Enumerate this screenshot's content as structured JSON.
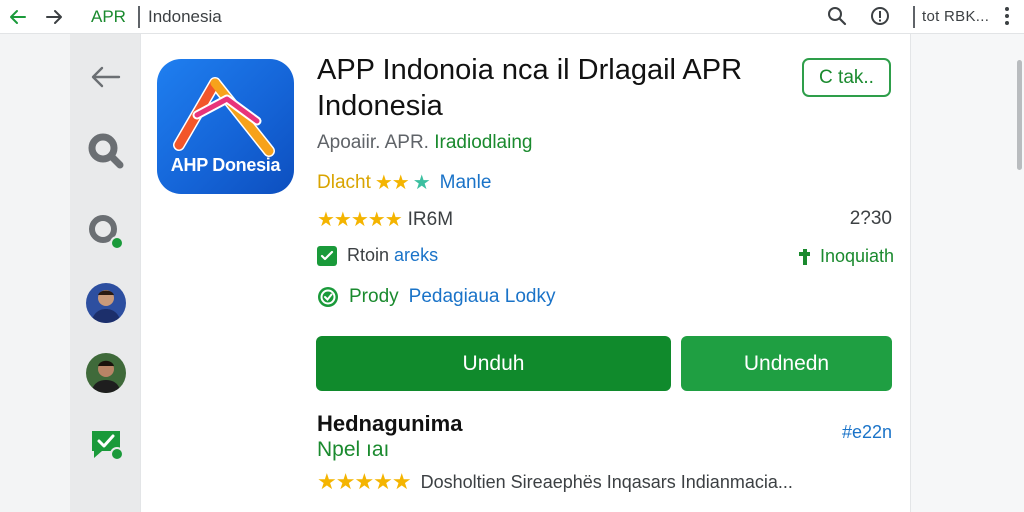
{
  "topbar": {
    "site": "APR",
    "page": "Indonesia",
    "right_text": "tot RBK..."
  },
  "app": {
    "icon_text": "AHP Donesia",
    "title": "APP Indonoia nca il Drlagail APR Indonesia",
    "developer_plain": "Apoaiir. APR.",
    "developer_link": "Iradiodlaing",
    "top_button": "C tak..",
    "tag_label": "Dlacht",
    "tag_stars": "★★",
    "tag_star_teal": "★",
    "tag_text": "Manle",
    "rating_stars": "★★★★★",
    "rating_text": "IR6M",
    "rating_right": "2?30",
    "check_label_plain": "Rtoin",
    "check_label_blue": "areks",
    "check_right": "Inoquiath",
    "verify_green": "Prody",
    "verify_blue": "Pedagiaua Lodky",
    "primary_button": "Unduh",
    "secondary_button": "Undnedn"
  },
  "section": {
    "title": "Hednagunima",
    "subtitle": "Npel ıaı",
    "right": "#e22n",
    "review_stars": "★★★★★",
    "review_text": "Dosholtien Sireaephës Inqasars Indianmacia..."
  },
  "colors": {
    "accent_green": "#108a2c",
    "link_green": "#1a8a2e",
    "link_blue": "#1a73c8",
    "star": "#f4b400"
  }
}
